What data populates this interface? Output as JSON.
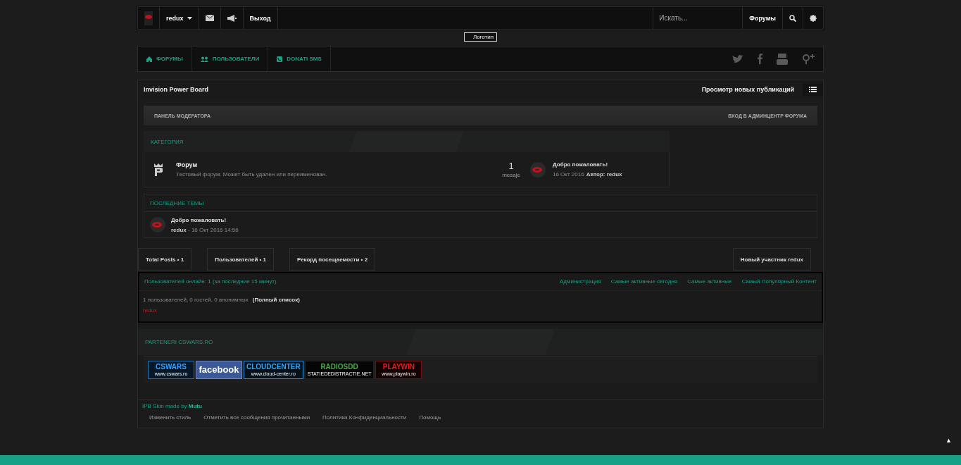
{
  "top_bar": {
    "user": "redux",
    "logout": "Выход",
    "search": {
      "placeholder": "Искать..."
    },
    "scope": "Форумы"
  },
  "logo": {
    "alt": "Логотип"
  },
  "nav": [
    {
      "label": "ФОРУМЫ"
    },
    {
      "label": "ПОЛЬЗОВАТЕЛИ"
    },
    {
      "label": "DONATI SMS"
    }
  ],
  "board": {
    "title": "Invision Power Board",
    "new_posts": "Просмотр новых публикаций"
  },
  "moderator_bar": {
    "left": "ПАНЕЛЬ МОДЕРАТОРА",
    "right": "ВХОД В АДМИНЦЕНТР ФОРУМА"
  },
  "category": {
    "title": "КАТЕГОРИЯ",
    "forums": [
      {
        "name": "Форум",
        "description": "Тестовый форум. Может быть удален или переименован.",
        "count": "1",
        "count_label": "mesaje",
        "last_title": "Добро пожаловать!",
        "last_date": "16 Окт 2016",
        "last_author": "Автор: redux"
      }
    ]
  },
  "latest": {
    "title": "ПОСЛЕДНИЕ ТЕМЫ",
    "topics": [
      {
        "title": "Добро пожаловать!",
        "author": "redux",
        "date": "- 16 Окт 2016 14:56"
      }
    ]
  },
  "stats": [
    {
      "label": "Total Posts •",
      "value": "1"
    },
    {
      "label": "Пользователей •",
      "value": "1"
    },
    {
      "label": "Рекорд посещаемости •",
      "value": "2"
    },
    {
      "label": "Новый участник",
      "value": "redux"
    }
  ],
  "online": {
    "title": "Пользователей онлайн: 1 (за последние 15 минут)",
    "links": [
      "Администрация",
      "Самые активные сегодня",
      "Самые активные",
      "Самый Популярный Контент"
    ],
    "summary": "1 пользователей, 0 гостей, 0 анонимных",
    "full_list": "(Полный список)",
    "users": [
      "redux"
    ]
  },
  "partners": {
    "title": "PARTENERI CSWARS.RO",
    "banners": [
      {
        "kind": "cswars",
        "title": "CSWARS",
        "subtitle": "www.cswars.ro"
      },
      {
        "kind": "facebook",
        "title": "facebook"
      },
      {
        "kind": "cloud",
        "title": "CLOUDCENTER",
        "subtitle": "www.cloud-center.ro"
      },
      {
        "kind": "radio",
        "title": "RADIOSDD",
        "subtitle": "STATIEDEDISTRACTIE.NET"
      },
      {
        "kind": "playwin",
        "title": "PLAYWIN",
        "subtitle": "www.playwin.ro"
      }
    ]
  },
  "footer": {
    "credit": "IPB Skin made by **Mutu**",
    "links": [
      "Изменить стиль",
      "Отметить все сообщения прочитанными",
      "Политика Конфиденциальности",
      "Помощь"
    ]
  },
  "back_to_top": "▲"
}
